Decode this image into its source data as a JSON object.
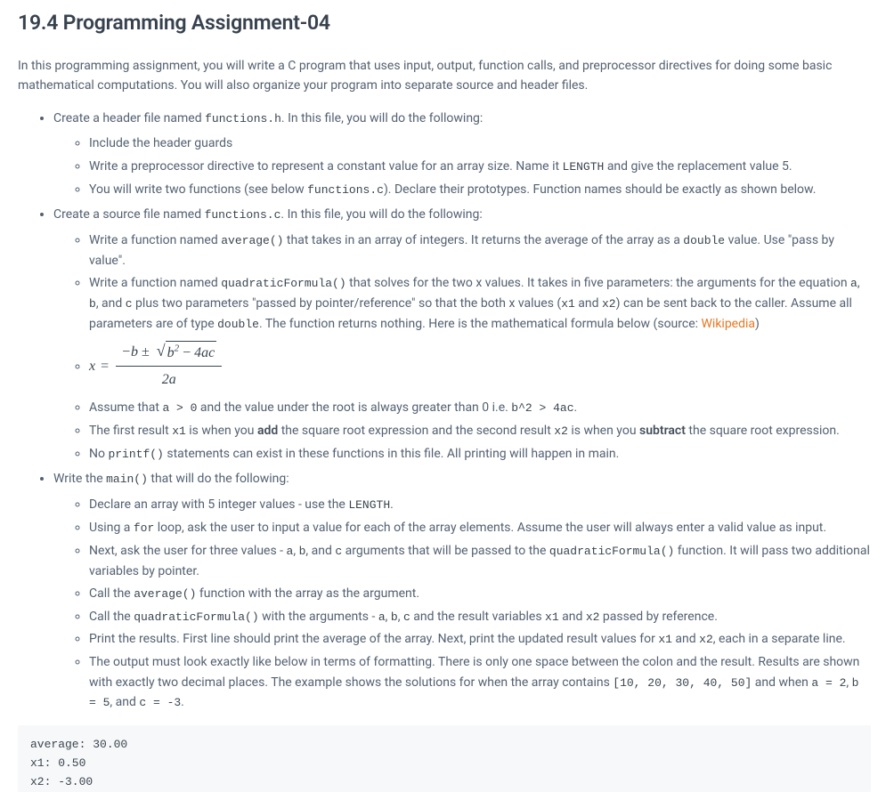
{
  "title": "19.4 Programming Assignment-04",
  "intro": "In this programming assignment, you will write a C program that uses input, output, function calls, and preprocessor directives for doing some basic mathematical computations. You will also organize your program into separate source and header files.",
  "bullets": {
    "header": {
      "pre": "Create a header file named ",
      "code": "functions.h",
      "post": ". In this file, you will do the following:",
      "items": [
        {
          "text": "Include the header guards"
        },
        {
          "parts": [
            {
              "t": "Write a preprocessor directive to represent a constant value for an array size. Name it "
            },
            {
              "c": "LENGTH"
            },
            {
              "t": " and give the replacement value 5."
            }
          ]
        },
        {
          "parts": [
            {
              "t": "You will write two functions (see below "
            },
            {
              "c": "functions.c"
            },
            {
              "t": "). Declare their prototypes. Function names should be exactly as shown below."
            }
          ]
        }
      ]
    },
    "source": {
      "pre": "Create a source file named ",
      "code": "functions.c",
      "post": ". In this file, you will do the following:",
      "items": [
        {
          "parts": [
            {
              "t": "Write a function named "
            },
            {
              "c": "average()"
            },
            {
              "t": " that takes in an array of integers. It returns the average of the array as a "
            },
            {
              "c": "double"
            },
            {
              "t": " value. Use \"pass by value\"."
            }
          ]
        },
        {
          "parts": [
            {
              "t": "Write a function named "
            },
            {
              "c": "quadraticFormula()"
            },
            {
              "t": " that solves for the two x values. It takes in five parameters: the arguments for the equation "
            },
            {
              "c": "a"
            },
            {
              "t": ", "
            },
            {
              "c": "b"
            },
            {
              "t": ", and "
            },
            {
              "c": "c"
            },
            {
              "t": " plus two parameters \"passed by pointer/reference\" so that the both x values ("
            },
            {
              "c": "x1"
            },
            {
              "t": " and "
            },
            {
              "c": "x2"
            },
            {
              "t": ") can be sent back to the caller. Assume all parameters are of type "
            },
            {
              "c": "double"
            },
            {
              "t": ". The function returns nothing. Here is the mathematical formula below (source: "
            },
            {
              "link": "Wikipedia"
            },
            {
              "t": ")"
            }
          ]
        },
        {
          "formula": true
        },
        {
          "parts": [
            {
              "t": "Assume that "
            },
            {
              "c": "a > 0"
            },
            {
              "t": " and the value under the root is always greater than 0 i.e. "
            },
            {
              "c": "b^2 > 4ac"
            },
            {
              "t": "."
            }
          ]
        },
        {
          "parts": [
            {
              "t": "The first result "
            },
            {
              "c": "x1"
            },
            {
              "t": " is when you "
            },
            {
              "b": "add"
            },
            {
              "t": " the square root expression and the second result "
            },
            {
              "c": "x2"
            },
            {
              "t": " is when you "
            },
            {
              "b": "subtract"
            },
            {
              "t": " the square root expression."
            }
          ]
        },
        {
          "parts": [
            {
              "t": "No "
            },
            {
              "c": "printf()"
            },
            {
              "t": " statements can exist in these functions in this file. All printing will happen in main."
            }
          ]
        }
      ]
    },
    "main": {
      "pre": "Write the ",
      "code": "main()",
      "post": " that will do the following:",
      "items": [
        {
          "parts": [
            {
              "t": "Declare an array with 5 integer values - use the "
            },
            {
              "c": "LENGTH"
            },
            {
              "t": "."
            }
          ]
        },
        {
          "parts": [
            {
              "t": "Using a "
            },
            {
              "c": "for"
            },
            {
              "t": " loop, ask the user to input a value for each of the array elements. Assume the user will always enter a valid value as input."
            }
          ]
        },
        {
          "parts": [
            {
              "t": "Next, ask the user for three values - "
            },
            {
              "c": "a"
            },
            {
              "t": ", "
            },
            {
              "c": "b"
            },
            {
              "t": ", and "
            },
            {
              "c": "c"
            },
            {
              "t": " arguments that will be passed to the "
            },
            {
              "c": "quadraticFormula()"
            },
            {
              "t": " function. It will pass two additional variables by pointer."
            }
          ]
        },
        {
          "parts": [
            {
              "t": "Call the "
            },
            {
              "c": "average()"
            },
            {
              "t": " function with the array as the argument."
            }
          ]
        },
        {
          "parts": [
            {
              "t": "Call the "
            },
            {
              "c": "quadraticFormula()"
            },
            {
              "t": " with the arguments - "
            },
            {
              "c": "a"
            },
            {
              "t": ", "
            },
            {
              "c": "b"
            },
            {
              "t": ", "
            },
            {
              "c": "c"
            },
            {
              "t": " and the result variables "
            },
            {
              "c": "x1"
            },
            {
              "t": " and "
            },
            {
              "c": "x2"
            },
            {
              "t": " passed by reference."
            }
          ]
        },
        {
          "parts": [
            {
              "t": "Print the results. First line should print the average of the array. Next, print the updated result values for "
            },
            {
              "c": "x1"
            },
            {
              "t": " and "
            },
            {
              "c": "x2"
            },
            {
              "t": ", each in a separate line."
            }
          ]
        },
        {
          "parts": [
            {
              "t": "The output must look exactly like below in terms of formatting. There is only one space between the colon and the result. Results are shown with exactly two decimal places. The example shows the solutions for when the array contains "
            },
            {
              "c": "[10, 20, 30, 40, 50]"
            },
            {
              "t": " and when "
            },
            {
              "c": "a = 2"
            },
            {
              "t": ", "
            },
            {
              "c": "b = 5"
            },
            {
              "t": ", and "
            },
            {
              "c": "c = -3"
            },
            {
              "t": "."
            }
          ]
        }
      ]
    }
  },
  "formula": {
    "lhs": "x",
    "eq": "=",
    "num_pre": "−b",
    "pm": "±",
    "rad_b": "b",
    "rad_sup": "2",
    "rad_minus": "−",
    "rad_4ac": "4ac",
    "den": "2a"
  },
  "output_example": "average: 30.00\nx1: 0.50\nx2: -3.00"
}
